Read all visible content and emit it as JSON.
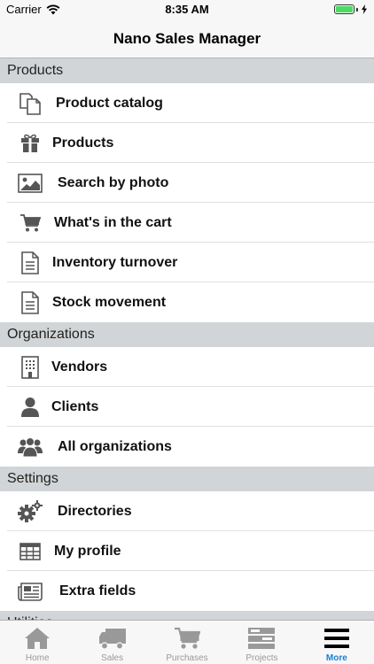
{
  "status_bar": {
    "carrier": "Carrier",
    "time": "8:35 AM"
  },
  "nav": {
    "title": "Nano Sales Manager"
  },
  "sections": {
    "products": {
      "header": "Products",
      "items": [
        "Product catalog",
        "Products",
        "Search by photo",
        "What's in the cart",
        "Inventory turnover",
        "Stock movement"
      ]
    },
    "organizations": {
      "header": "Organizations",
      "items": [
        "Vendors",
        "Clients",
        "All organizations"
      ]
    },
    "settings": {
      "header": "Settings",
      "items": [
        "Directories",
        "My profile",
        "Extra fields"
      ]
    },
    "utilities": {
      "header": "Utilities"
    }
  },
  "tabs": [
    "Home",
    "Sales",
    "Purchases",
    "Projects",
    "More"
  ],
  "active_tab": "More",
  "colors": {
    "accent": "#1a7fd4",
    "section_bg": "#d2d5d7",
    "icon": "#555555",
    "tab_inactive": "#999999"
  }
}
